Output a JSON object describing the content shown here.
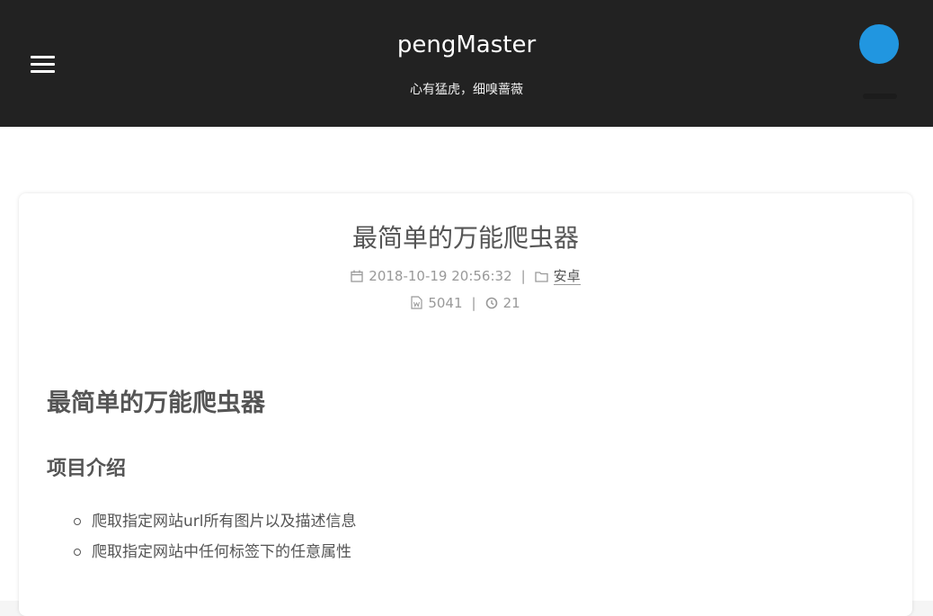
{
  "site": {
    "title": "pengMaster",
    "subtitle": "心有猛虎，细嗅蔷薇"
  },
  "header_icons": {
    "menu": "hamburger-menu-icon",
    "avatar_color": "#2196e0"
  },
  "post": {
    "title": "最简单的万能爬虫器",
    "date": "2018-10-19 20:56:32",
    "category": "安卓",
    "word_count": "5041",
    "read_time": "21",
    "separator": "|"
  },
  "content": {
    "h1": "最简单的万能爬虫器",
    "h2": "项目介绍",
    "list": [
      "爬取指定网站url所有图片以及描述信息",
      "爬取指定网站中任何标签下的任意属性"
    ]
  },
  "colors": {
    "header_bg": "#222222",
    "text": "#555555",
    "meta": "#999999"
  }
}
